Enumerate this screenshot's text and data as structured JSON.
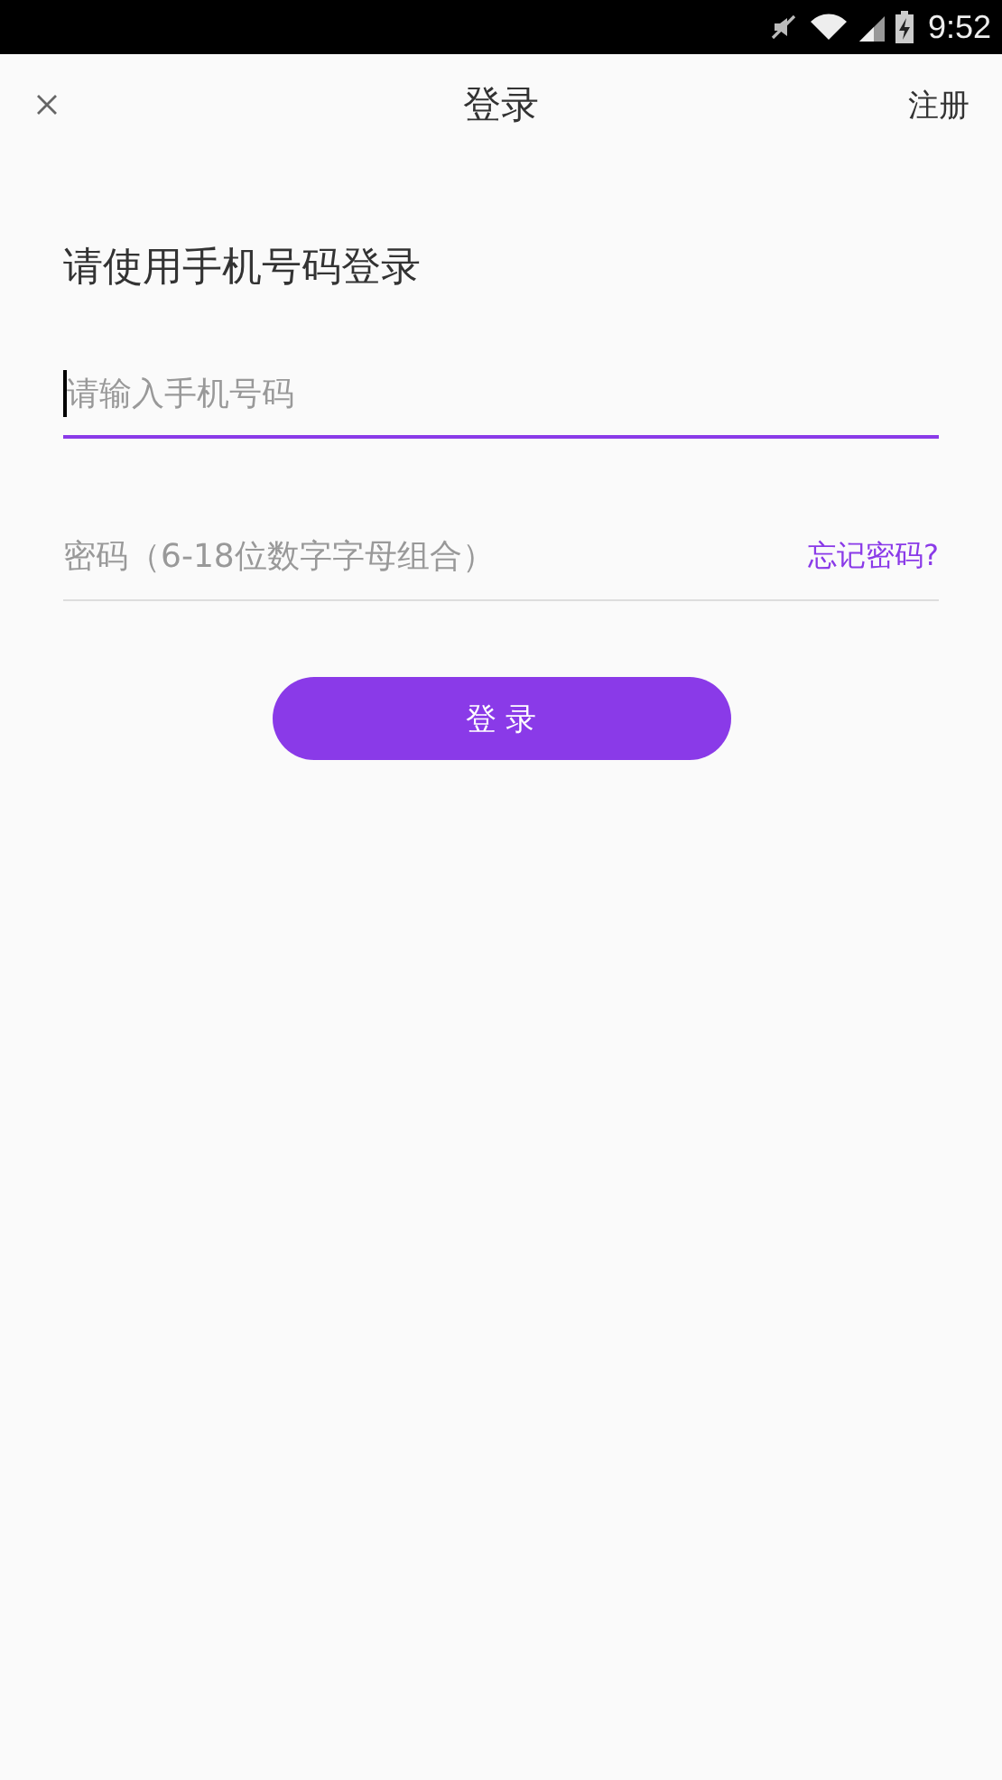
{
  "status_bar": {
    "time": "9:52"
  },
  "header": {
    "title": "登录",
    "action": "注册"
  },
  "heading": "请使用手机号码登录",
  "fields": [
    {
      "placeholder": "请输入手机号码",
      "focused": true
    },
    {
      "placeholder": "密码（6-18位数字字母组合）",
      "focused": false,
      "link": "忘记密码?"
    }
  ],
  "submit": "登 录"
}
